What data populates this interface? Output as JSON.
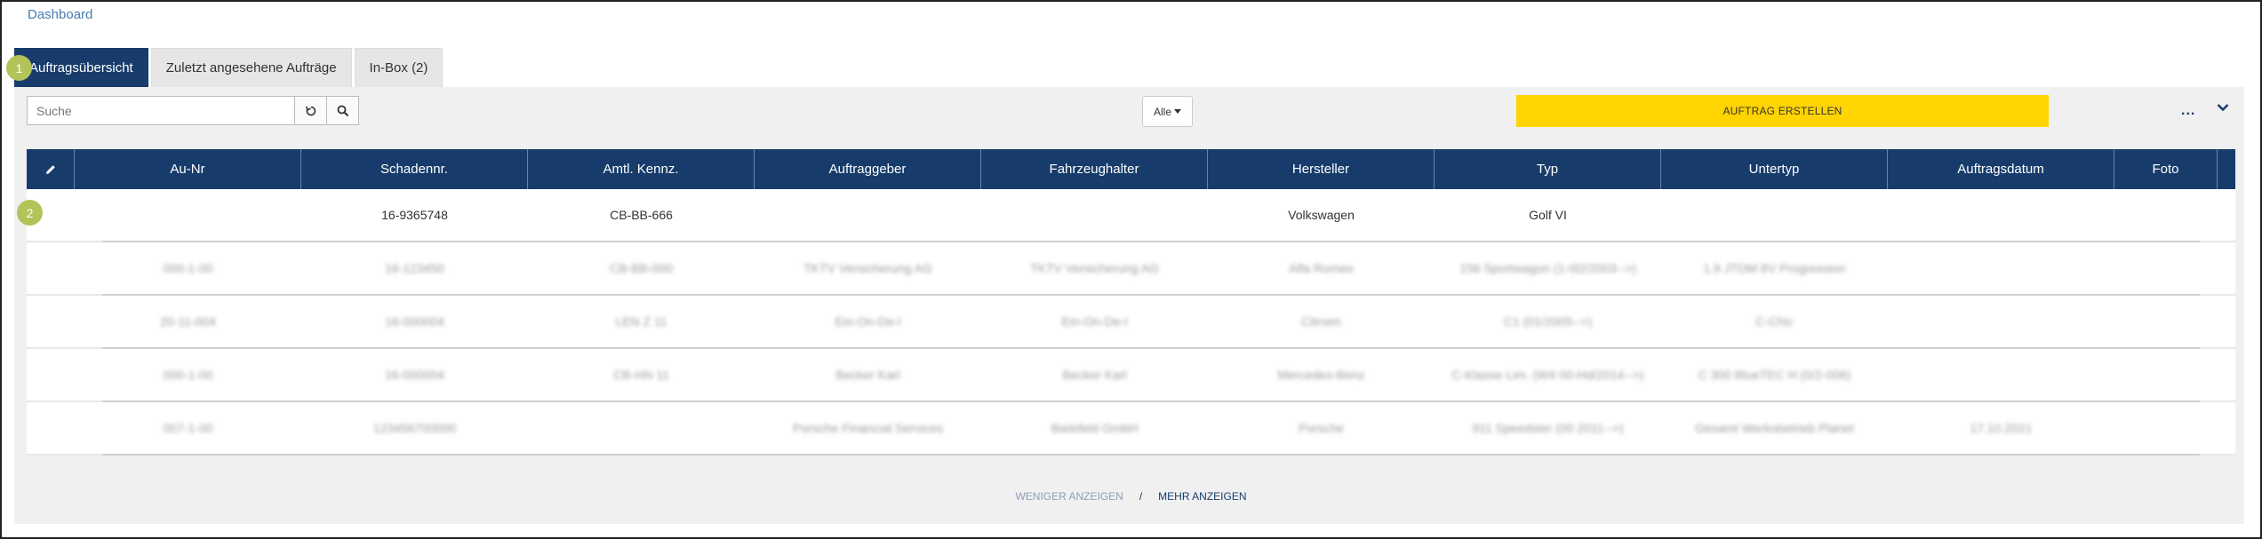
{
  "breadcrumb": "Dashboard",
  "tabs": [
    {
      "label": "Auftragsübersicht",
      "active": true
    },
    {
      "label": "Zuletzt angesehene Aufträge",
      "active": false
    },
    {
      "label": "In-Box (2)",
      "active": false
    }
  ],
  "badges": [
    "1",
    "2"
  ],
  "search": {
    "placeholder": "Suche",
    "value": ""
  },
  "filter": {
    "selected": "Alle"
  },
  "create_button": "AUFTRAG ERSTELLEN",
  "more_menu": "...",
  "colors": {
    "header": "#173c6b",
    "create": "#ffd400",
    "badge": "#b3c35a"
  },
  "table": {
    "columns": [
      "",
      "Au-Nr",
      "Schadennr.",
      "Amtl. Kennz.",
      "Auftraggeber",
      "Fahrzeughalter",
      "Hersteller",
      "Typ",
      "Untertyp",
      "Auftragsdatum",
      "Foto"
    ],
    "rows": [
      {
        "au_nr": "",
        "schadennr": "16-9365748",
        "kennz": "CB-BB-666",
        "auftraggeber": "",
        "halter": "",
        "hersteller": "Volkswagen",
        "typ": "Golf VI",
        "untertyp": "",
        "datum": "",
        "foto": "",
        "blurred": false
      },
      {
        "au_nr": "000-1-00",
        "schadennr": "16-123450",
        "kennz": "CB-BB-000",
        "auftraggeber": "TKTV Versicherung AG",
        "halter": "TKTV Versicherung AG",
        "hersteller": "Alfa Romeo",
        "typ": "156 Sportwagon (1-0l2/2003-->)",
        "untertyp": "1.9 JTDM 8V Progression",
        "datum": "",
        "foto": "",
        "blurred": true
      },
      {
        "au_nr": "20-11-004",
        "schadennr": "16-000004",
        "kennz": "LEN Z 11",
        "auftraggeber": "Ein-On-De-l",
        "halter": "Ein-On-De-l",
        "hersteller": "Citroen",
        "typ": "C1 (01/2005-->)",
        "untertyp": "C-Chic",
        "datum": "",
        "foto": "",
        "blurred": true
      },
      {
        "au_nr": "000-1-00",
        "schadennr": "16-000004",
        "kennz": "CB-HN 11",
        "auftraggeber": "Becker Karl",
        "halter": "Becker Karl",
        "hersteller": "Mercedes-Benz",
        "typ": "C-Klasse Lim. (W4 00-Hd/2014-->)",
        "untertyp": "C 300 BlueTEC H (0/2-006)",
        "datum": "",
        "foto": "",
        "blurred": true
      },
      {
        "au_nr": "007-1-00",
        "schadennr": "123456700000",
        "kennz": "",
        "auftraggeber": "Porsche Financial Services",
        "halter": "Bielefeld GmbH",
        "hersteller": "Porsche",
        "typ": "911 Speedster (00 2011-->)",
        "untertyp": "Gesamt Werksbetrieb Planet",
        "datum": "17.10.2021",
        "foto": "",
        "blurred": true
      }
    ]
  },
  "footer": {
    "less": "WENIGER ANZEIGEN",
    "separator": "/",
    "more": "MEHR ANZEIGEN"
  }
}
